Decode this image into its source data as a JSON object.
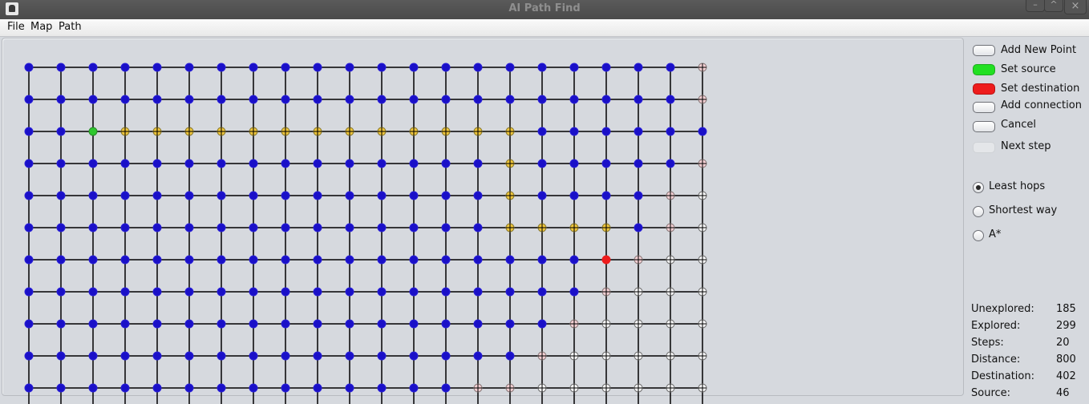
{
  "window": {
    "title": "AI Path Find",
    "controls": {
      "minimize": "–",
      "maximize": "^",
      "close": "×"
    }
  },
  "menu": [
    "File",
    "Map",
    "Path"
  ],
  "side": {
    "buttons": [
      {
        "label": "Add New Point",
        "style": "plain"
      },
      {
        "label": "Set source",
        "style": "green"
      },
      {
        "label": "Set destination",
        "style": "red"
      },
      {
        "label": "Add connection",
        "style": "plain"
      },
      {
        "label": "Cancel",
        "style": "plain"
      },
      {
        "label": "Next step",
        "style": "disabled"
      }
    ],
    "algorithms": [
      {
        "label": "Least hops",
        "selected": true
      },
      {
        "label": "Shortest way",
        "selected": false
      },
      {
        "label": "A*",
        "selected": false
      }
    ],
    "stats": [
      {
        "label": "Unexplored:",
        "value": "185"
      },
      {
        "label": "Explored:",
        "value": "299"
      },
      {
        "label": "Steps:",
        "value": "20"
      },
      {
        "label": "Distance:",
        "value": "800"
      },
      {
        "label": "Destination:",
        "value": "402"
      },
      {
        "label": "Source:",
        "value": "46"
      }
    ]
  },
  "grid": {
    "columns": 22,
    "rows": 11,
    "legend": {
      "B": "explored",
      "Y": "path",
      "S": "source",
      "D": "destination",
      "P": "frontier",
      "W": "unexplored"
    },
    "colors": {
      "explored": "#1a10c8",
      "path": "#f2c62e",
      "source": "#2ec82e",
      "destination": "#ee1c1c",
      "frontier": "#f6cfd2",
      "unexplored": "#ffffff",
      "edge": "#000000"
    },
    "node_states": [
      "BBBBBBBBBBBBBBBBBBBBBP",
      "BBBBBBBBBBBBBBBBBBBBBP",
      "BBSYYYYYYYYYYYYYBBBBBB",
      "BBBBBBBBBBBBBBBYBBBBBP",
      "BBBBBBBBBBBBBBBYBBBBPW",
      "BBBBBBBBBBBBBBBYYYYBPW",
      "BBBBBBBBBBBBBBBBBBDPWW",
      "BBBBBBBBBBBBBBBBBBPWWW",
      "BBBBBBBBBBBBBBBBBPWWWW",
      "BBBBBBBBBBBBBBBBPWWWWW",
      "BBBBBBBBBBBBBBPPWWWWWW"
    ]
  }
}
